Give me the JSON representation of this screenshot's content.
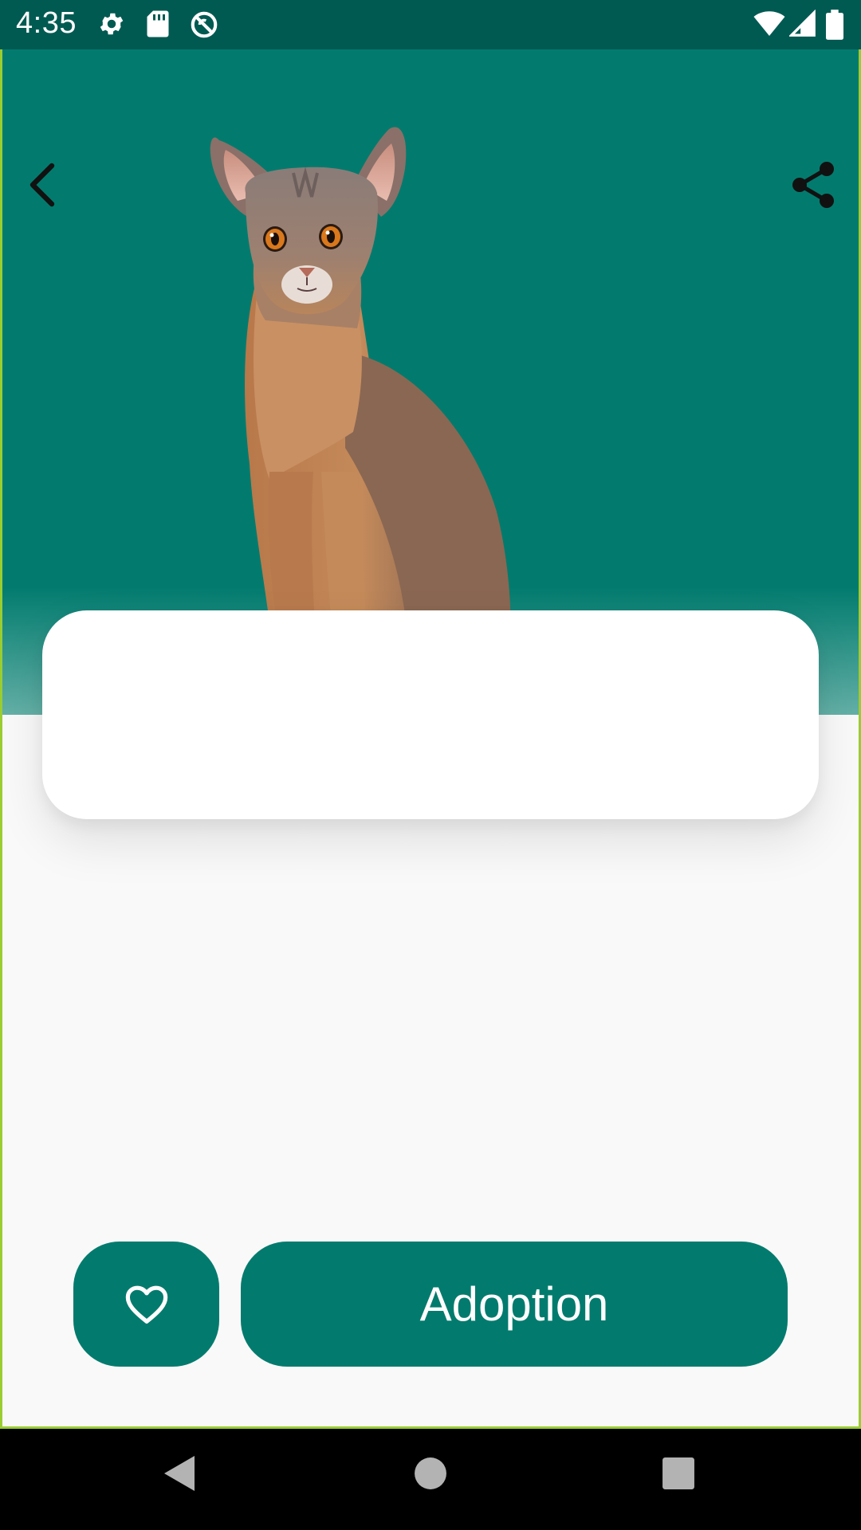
{
  "status_bar": {
    "time": "4:35",
    "icons": [
      "gear-icon",
      "sd-card-icon",
      "sync-off-icon",
      "wifi-icon",
      "cell-signal-icon",
      "battery-icon"
    ]
  },
  "toolbar": {
    "back_icon": "chevron-left-icon",
    "share_icon": "share-icon"
  },
  "hero": {
    "background_color": "#027b6e",
    "image": "cat-photo"
  },
  "actions": {
    "favorite_icon": "heart-outline-icon",
    "adoption_label": "Adoption",
    "button_color": "#027b6e"
  },
  "nav_bar": {
    "icons": [
      "back-triangle-icon",
      "home-circle-icon",
      "recents-square-icon"
    ]
  }
}
